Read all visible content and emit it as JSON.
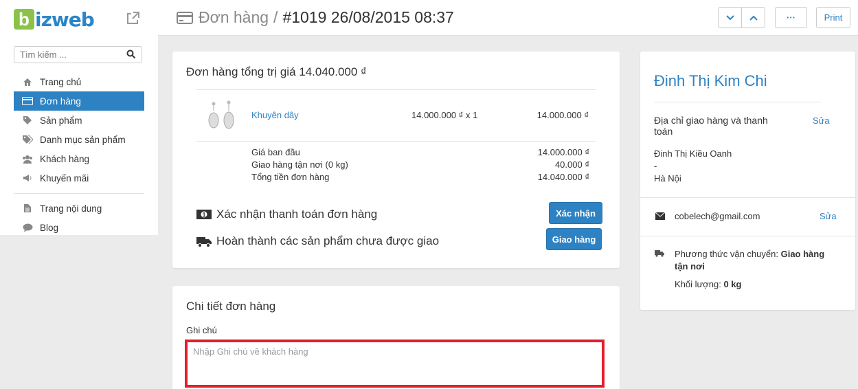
{
  "sidebar": {
    "logo_text": "izweb",
    "logo_letter": "b",
    "search_placeholder": "Tìm kiếm ...",
    "items": [
      {
        "label": "Trang chủ",
        "icon": "home-icon"
      },
      {
        "label": "Đơn hàng",
        "icon": "credit-card-icon"
      },
      {
        "label": "Sản phẩm",
        "icon": "tag-icon"
      },
      {
        "label": "Danh mục sản phẩm",
        "icon": "tags-icon"
      },
      {
        "label": "Khách hàng",
        "icon": "users-icon"
      },
      {
        "label": "Khuyến mãi",
        "icon": "megaphone-icon"
      }
    ],
    "items2": [
      {
        "label": "Trang nội dung",
        "icon": "file-icon"
      },
      {
        "label": "Blog",
        "icon": "comment-icon"
      }
    ]
  },
  "header": {
    "crumb": "Đơn hàng",
    "separator": "/",
    "order_title": "#1019 26/08/2015 08:37",
    "more_label": "···",
    "print_label": "Print"
  },
  "order": {
    "title": "Đơn hàng tổng trị giá 14.040.000 ₫",
    "product": {
      "name": "Khuyên dây",
      "price_qty": "14.000.000 ₫ x 1",
      "total": "14.000.000 ₫"
    },
    "summary": [
      {
        "label": "Giá ban đầu",
        "value": "14.000.000 ₫"
      },
      {
        "label": "Giao hàng tận nơi (0 kg)",
        "value": "40.000 ₫"
      },
      {
        "label": "Tổng tiền đơn hàng",
        "value": "14.040.000 ₫"
      }
    ],
    "confirm_text": "Xác nhận thanh toán đơn hàng",
    "confirm_button": "Xác nhận",
    "ship_text": "Hoàn thành các sản phẩm chưa được giao",
    "ship_button": "Giao hàng"
  },
  "details": {
    "title": "Chi tiết đơn hàng",
    "note_label": "Ghi chú",
    "note_placeholder": "Nhập Ghi chú về khách hàng",
    "note_value": ""
  },
  "customer": {
    "name": "Đinh Thị Kim Chi",
    "address_label": "Địa chỉ giao hàng và thanh toán",
    "edit_label": "Sửa",
    "address_name": "Đinh Thị Kiều Oanh",
    "address_line": "-",
    "address_city": "Hà Nội",
    "email": "cobelech@gmail.com",
    "shipping_label": "Phương thức vận chuyển:",
    "shipping_value": "Giao hàng tận nơi",
    "weight_label": "Khối lượng:",
    "weight_value": "0 kg"
  },
  "colors": {
    "accent": "#2d82c3",
    "logo_green": "#8bc34a",
    "highlight_border": "#e21f2a"
  }
}
